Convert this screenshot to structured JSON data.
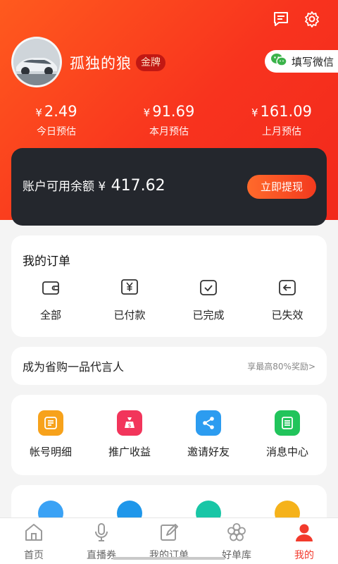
{
  "header": {
    "username": "孤独的狼",
    "badge": "金牌",
    "wechat_button": "填写微信",
    "icons": [
      "message-icon",
      "gear-icon"
    ]
  },
  "stats": [
    {
      "currency": "¥",
      "value": "2.49",
      "label": "今日预估"
    },
    {
      "currency": "¥",
      "value": "91.69",
      "label": "本月预估"
    },
    {
      "currency": "¥",
      "value": "161.09",
      "label": "上月预估"
    }
  ],
  "balance": {
    "label": "账户可用余额",
    "currency": "¥",
    "amount": "417.62",
    "withdraw_button": "立即提现"
  },
  "orders": {
    "title": "我的订单",
    "items": [
      {
        "label": "全部",
        "icon": "wallet-icon"
      },
      {
        "label": "已付款",
        "icon": "yen-receipt-icon"
      },
      {
        "label": "已完成",
        "icon": "completed-icon"
      },
      {
        "label": "已失效",
        "icon": "return-icon"
      }
    ]
  },
  "promo": {
    "text": "成为省购一品代言人",
    "reward": "享最高80%奖励>"
  },
  "tools": [
    {
      "label": "帐号明细",
      "icon": "list-icon",
      "color": "#f7a21b"
    },
    {
      "label": "推广收益",
      "icon": "money-bag-icon",
      "color": "#f2355b"
    },
    {
      "label": "邀请好友",
      "icon": "share-icon",
      "color": "#2c9cf0"
    },
    {
      "label": "消息中心",
      "icon": "message-center-icon",
      "color": "#21c45b"
    }
  ],
  "more_icons": [
    {
      "icon": "cloud-icon",
      "color": "#3aa2f5"
    },
    {
      "icon": "headset-icon",
      "color": "#1f97ea"
    },
    {
      "icon": "circle-icon",
      "color": "#19c6a6"
    },
    {
      "icon": "refresh-icon",
      "color": "#f5b21b"
    }
  ],
  "tabs": [
    {
      "label": "首页",
      "icon": "home-icon",
      "active": false
    },
    {
      "label": "直播券",
      "icon": "microphone-icon",
      "active": false
    },
    {
      "label": "我的订单",
      "icon": "edit-icon",
      "active": false
    },
    {
      "label": "好单库",
      "icon": "flower-icon",
      "active": false
    },
    {
      "label": "我的",
      "icon": "user-icon",
      "active": true
    }
  ],
  "colors": {
    "brand": "#f2291c",
    "active_tab": "#f23a2c",
    "balance_card": "#24272d"
  }
}
